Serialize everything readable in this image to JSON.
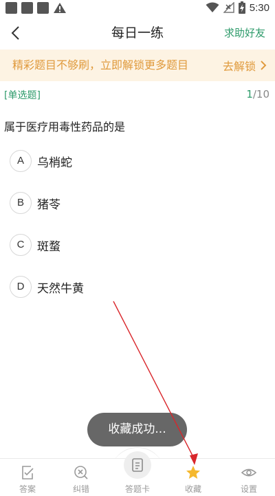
{
  "status_bar": {
    "time": "5:30",
    "icons": [
      "notification-icon",
      "notification-icon",
      "notification-icon",
      "warning-icon",
      "wifi-icon",
      "no-signal-icon",
      "battery-charging-icon"
    ]
  },
  "header": {
    "title": "每日一练",
    "right_link": "求助好友",
    "back_icon": "back-arrow-icon"
  },
  "banner": {
    "text": "精彩题目不够刷，立即解锁更多题目",
    "action_label": "去解锁",
    "action_icon": "chevron-right-icon"
  },
  "question": {
    "type": "[单选题]",
    "current": "1",
    "total": "/10",
    "text": "属于医疗用毒性药品的是",
    "options": [
      {
        "letter": "A",
        "text": "乌梢蛇"
      },
      {
        "letter": "B",
        "text": "猪苓"
      },
      {
        "letter": "C",
        "text": "斑蝥"
      },
      {
        "letter": "D",
        "text": "天然牛黄"
      }
    ]
  },
  "toast": {
    "text": "收藏成功..."
  },
  "tabbar": {
    "items": [
      {
        "label": "答案",
        "icon": "answer-icon"
      },
      {
        "label": "纠错",
        "icon": "error-report-icon"
      },
      {
        "label": "答题卡",
        "icon": "answer-card-icon"
      },
      {
        "label": "收藏",
        "icon": "star-icon"
      },
      {
        "label": "设置",
        "icon": "eye-icon"
      }
    ]
  },
  "colors": {
    "accent": "#2e9b6b",
    "banner_bg": "#fdf3e3",
    "banner_text": "#e09a3c",
    "star": "#f5b82e",
    "annotation_arrow": "#d9262b"
  }
}
